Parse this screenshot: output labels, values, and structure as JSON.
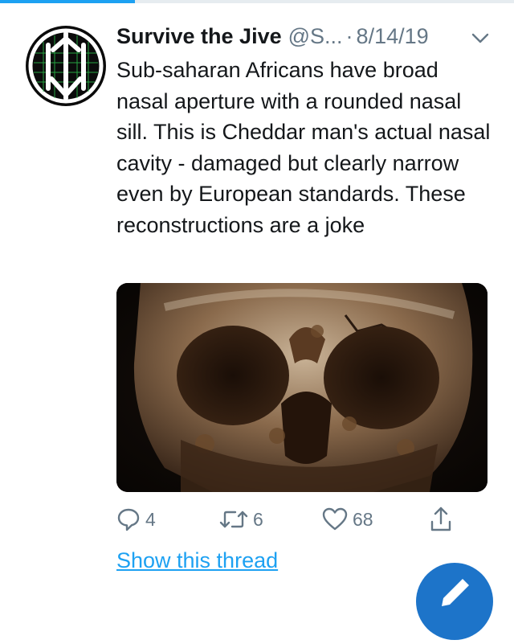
{
  "tweet": {
    "author_name": "Survive the Jive",
    "author_handle": "@S...",
    "separator": "·",
    "date": "8/14/19",
    "text": "Sub-saharan Africans have broad nasal aperture with a rounded nasal sill. This is Cheddar man's actual nasal cavity - damaged but clearly narrow even by European standards. These reconstructions are a joke",
    "replies": "4",
    "retweets": "6",
    "likes": "68",
    "show_thread_label": "Show this thread"
  },
  "colors": {
    "accent": "#1da1f2",
    "secondary_text": "#657786",
    "primary_text": "#14171a",
    "fab": "#1d74c9"
  },
  "icons": {
    "chevron": "chevron-down-icon",
    "reply": "reply-icon",
    "retweet": "retweet-icon",
    "like": "heart-icon",
    "share": "share-icon",
    "compose": "compose-icon"
  }
}
